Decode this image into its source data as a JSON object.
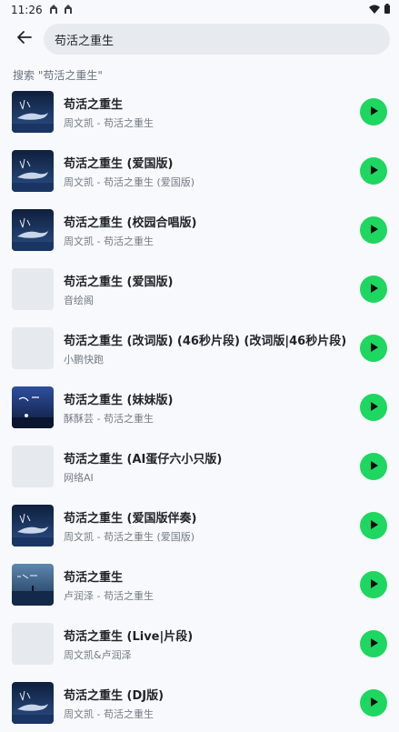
{
  "status_bar": {
    "time": "11:26",
    "notif_icons": [
      "notification-icon",
      "notification-icon"
    ],
    "wifi_icon": "wifi-icon",
    "battery_icon": "battery-icon"
  },
  "search": {
    "value": "苟活之重生",
    "back_icon": "arrow-left-icon"
  },
  "hint": "搜索 \"苟活之重生\"",
  "results": [
    {
      "title": "苟活之重生",
      "subtitle": "周文凯 - 苟活之重生",
      "art": "whale"
    },
    {
      "title": "苟活之重生 (爱国版)",
      "subtitle": "周文凯 - 苟活之重生 (爱国版)",
      "art": "whale"
    },
    {
      "title": "苟活之重生 (校园合唱版)",
      "subtitle": "周文凯 - 苟活之重生",
      "art": "whale"
    },
    {
      "title": "苟活之重生 (爱国版)",
      "subtitle": "音绘阁",
      "art": "none"
    },
    {
      "title": "苟活之重生 (改词版) (46秒片段) (改词版|46秒片段)",
      "subtitle": "小鹏快跑",
      "art": "none"
    },
    {
      "title": "苟活之重生 (妹妹版)",
      "subtitle": "酥酥芸 - 苟活之重生",
      "art": "night"
    },
    {
      "title": "苟活之重生 (AI蛋仔六小只版)",
      "subtitle": "网络AI",
      "art": "none"
    },
    {
      "title": "苟活之重生 (爱国版伴奏)",
      "subtitle": "周文凯 - 苟活之重生 (爱国版)",
      "art": "whale"
    },
    {
      "title": "苟活之重生",
      "subtitle": "卢润泽 - 苟活之重生",
      "art": "sea"
    },
    {
      "title": "苟活之重生 (Live|片段)",
      "subtitle": "周文凯&卢润泽",
      "art": "none"
    },
    {
      "title": "苟活之重生 (DJ版)",
      "subtitle": "周文凯 - 苟活之重生",
      "art": "whale"
    }
  ],
  "colors": {
    "accent": "#1ed760",
    "background": "#f7f9fc",
    "search_bg": "#e7eaee"
  }
}
